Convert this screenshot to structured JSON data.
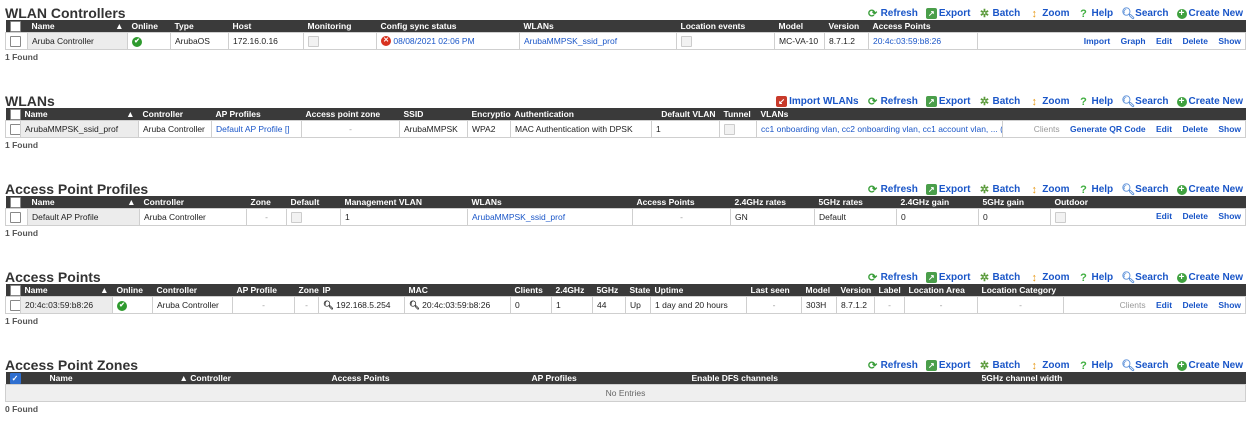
{
  "actions": {
    "refresh": "Refresh",
    "export": "Export",
    "batch": "Batch",
    "zoom": "Zoom",
    "help": "Help",
    "search": "Search",
    "create_new": "Create New",
    "import_wlans": "Import WLANs"
  },
  "controllers": {
    "title": "WLAN Controllers",
    "headers": [
      "Name",
      "Online",
      "Type",
      "Host",
      "Monitoring",
      "Config sync status",
      "WLANs",
      "Location events",
      "Model",
      "Version",
      "Access Points"
    ],
    "row": {
      "name": "Aruba Controller",
      "type": "ArubaOS",
      "host": "172.16.0.16",
      "sync": "08/08/2021 02:06 PM",
      "wlans": "ArubaMMPSK_ssid_prof",
      "model": "MC-VA-10",
      "version": "8.7.1.2",
      "ap": "20:4c:03:59:b8:26",
      "act_import": "Import",
      "act_graph": "Graph",
      "act_edit": "Edit",
      "act_delete": "Delete",
      "act_show": "Show"
    },
    "found": "1 Found"
  },
  "wlans": {
    "title": "WLANs",
    "headers": [
      "Name",
      "Controller",
      "AP Profiles",
      "Access point zone",
      "SSID",
      "Encryption",
      "Authentication",
      "Default VLAN",
      "Tunnel",
      "VLANs"
    ],
    "row": {
      "name": "ArubaMMPSK_ssid_prof",
      "controller": "Aruba Controller",
      "ap_profiles": "Default AP Profile []",
      "zone": "-",
      "ssid": "ArubaMMPSK",
      "encryption": "WPA2",
      "auth": "MAC Authentication with DPSK",
      "vlan": "1",
      "vlans": "cc1 onboarding vlan, cc2 onboarding vlan, cc1 account vlan, ... (4)",
      "act_clients": "Clients",
      "act_qr": "Generate QR Code",
      "act_edit": "Edit",
      "act_delete": "Delete",
      "act_show": "Show"
    },
    "found": "1 Found"
  },
  "profiles": {
    "title": "Access Point Profiles",
    "headers": [
      "Name",
      "Controller",
      "Zone",
      "Default",
      "Management VLAN",
      "WLANs",
      "Access Points",
      "2.4GHz rates",
      "5GHz rates",
      "2.4GHz gain",
      "5GHz gain",
      "Outdoor"
    ],
    "row": {
      "name": "Default AP Profile",
      "controller": "Aruba Controller",
      "zone": "-",
      "mgmt_vlan": "1",
      "wlans": "ArubaMMPSK_ssid_prof",
      "aps": "-",
      "rates24": "GN",
      "rates5": "Default",
      "gain24": "0",
      "gain5": "0",
      "act_edit": "Edit",
      "act_delete": "Delete",
      "act_show": "Show"
    },
    "found": "1 Found"
  },
  "aps": {
    "title": "Access Points",
    "headers": [
      "Name",
      "Online",
      "Controller",
      "AP Profile",
      "Zone",
      "IP",
      "MAC",
      "Clients",
      "2.4GHz",
      "5GHz",
      "State",
      "Uptime",
      "Last seen",
      "Model",
      "Version",
      "Label",
      "Location Area",
      "Location Category"
    ],
    "row": {
      "name": "20:4c:03:59:b8:26",
      "controller": "Aruba Controller",
      "profile": "-",
      "zone": "-",
      "ip": "192.168.5.254",
      "mac": "20:4c:03:59:b8:26",
      "clients": "0",
      "g24": "1",
      "g5": "44",
      "state": "Up",
      "uptime": "1 day and 20 hours",
      "last_seen": "-",
      "model": "303H",
      "version": "8.7.1.2",
      "label": "-",
      "area": "-",
      "category": "-",
      "act_clients": "Clients",
      "act_edit": "Edit",
      "act_delete": "Delete",
      "act_show": "Show"
    },
    "found": "1 Found"
  },
  "zones": {
    "title": "Access Point Zones",
    "headers": [
      "Name",
      "Controller",
      "Access Points",
      "AP Profiles",
      "Enable DFS channels",
      "5GHz channel width"
    ],
    "empty": "No Entries",
    "found": "0 Found"
  }
}
